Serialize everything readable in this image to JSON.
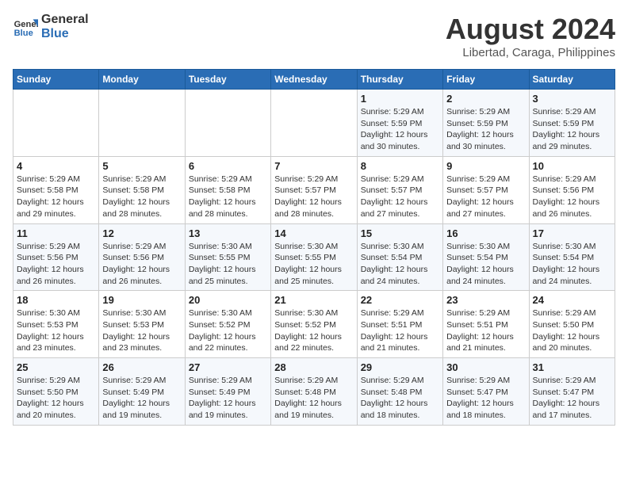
{
  "logo": {
    "line1": "General",
    "line2": "Blue"
  },
  "title": "August 2024",
  "subtitle": "Libertad, Caraga, Philippines",
  "days_of_week": [
    "Sunday",
    "Monday",
    "Tuesday",
    "Wednesday",
    "Thursday",
    "Friday",
    "Saturday"
  ],
  "weeks": [
    [
      {
        "day": "",
        "info": ""
      },
      {
        "day": "",
        "info": ""
      },
      {
        "day": "",
        "info": ""
      },
      {
        "day": "",
        "info": ""
      },
      {
        "day": "1",
        "info": "Sunrise: 5:29 AM\nSunset: 5:59 PM\nDaylight: 12 hours\nand 30 minutes."
      },
      {
        "day": "2",
        "info": "Sunrise: 5:29 AM\nSunset: 5:59 PM\nDaylight: 12 hours\nand 30 minutes."
      },
      {
        "day": "3",
        "info": "Sunrise: 5:29 AM\nSunset: 5:59 PM\nDaylight: 12 hours\nand 29 minutes."
      }
    ],
    [
      {
        "day": "4",
        "info": "Sunrise: 5:29 AM\nSunset: 5:58 PM\nDaylight: 12 hours\nand 29 minutes."
      },
      {
        "day": "5",
        "info": "Sunrise: 5:29 AM\nSunset: 5:58 PM\nDaylight: 12 hours\nand 28 minutes."
      },
      {
        "day": "6",
        "info": "Sunrise: 5:29 AM\nSunset: 5:58 PM\nDaylight: 12 hours\nand 28 minutes."
      },
      {
        "day": "7",
        "info": "Sunrise: 5:29 AM\nSunset: 5:57 PM\nDaylight: 12 hours\nand 28 minutes."
      },
      {
        "day": "8",
        "info": "Sunrise: 5:29 AM\nSunset: 5:57 PM\nDaylight: 12 hours\nand 27 minutes."
      },
      {
        "day": "9",
        "info": "Sunrise: 5:29 AM\nSunset: 5:57 PM\nDaylight: 12 hours\nand 27 minutes."
      },
      {
        "day": "10",
        "info": "Sunrise: 5:29 AM\nSunset: 5:56 PM\nDaylight: 12 hours\nand 26 minutes."
      }
    ],
    [
      {
        "day": "11",
        "info": "Sunrise: 5:29 AM\nSunset: 5:56 PM\nDaylight: 12 hours\nand 26 minutes."
      },
      {
        "day": "12",
        "info": "Sunrise: 5:29 AM\nSunset: 5:56 PM\nDaylight: 12 hours\nand 26 minutes."
      },
      {
        "day": "13",
        "info": "Sunrise: 5:30 AM\nSunset: 5:55 PM\nDaylight: 12 hours\nand 25 minutes."
      },
      {
        "day": "14",
        "info": "Sunrise: 5:30 AM\nSunset: 5:55 PM\nDaylight: 12 hours\nand 25 minutes."
      },
      {
        "day": "15",
        "info": "Sunrise: 5:30 AM\nSunset: 5:54 PM\nDaylight: 12 hours\nand 24 minutes."
      },
      {
        "day": "16",
        "info": "Sunrise: 5:30 AM\nSunset: 5:54 PM\nDaylight: 12 hours\nand 24 minutes."
      },
      {
        "day": "17",
        "info": "Sunrise: 5:30 AM\nSunset: 5:54 PM\nDaylight: 12 hours\nand 24 minutes."
      }
    ],
    [
      {
        "day": "18",
        "info": "Sunrise: 5:30 AM\nSunset: 5:53 PM\nDaylight: 12 hours\nand 23 minutes."
      },
      {
        "day": "19",
        "info": "Sunrise: 5:30 AM\nSunset: 5:53 PM\nDaylight: 12 hours\nand 23 minutes."
      },
      {
        "day": "20",
        "info": "Sunrise: 5:30 AM\nSunset: 5:52 PM\nDaylight: 12 hours\nand 22 minutes."
      },
      {
        "day": "21",
        "info": "Sunrise: 5:30 AM\nSunset: 5:52 PM\nDaylight: 12 hours\nand 22 minutes."
      },
      {
        "day": "22",
        "info": "Sunrise: 5:29 AM\nSunset: 5:51 PM\nDaylight: 12 hours\nand 21 minutes."
      },
      {
        "day": "23",
        "info": "Sunrise: 5:29 AM\nSunset: 5:51 PM\nDaylight: 12 hours\nand 21 minutes."
      },
      {
        "day": "24",
        "info": "Sunrise: 5:29 AM\nSunset: 5:50 PM\nDaylight: 12 hours\nand 20 minutes."
      }
    ],
    [
      {
        "day": "25",
        "info": "Sunrise: 5:29 AM\nSunset: 5:50 PM\nDaylight: 12 hours\nand 20 minutes."
      },
      {
        "day": "26",
        "info": "Sunrise: 5:29 AM\nSunset: 5:49 PM\nDaylight: 12 hours\nand 19 minutes."
      },
      {
        "day": "27",
        "info": "Sunrise: 5:29 AM\nSunset: 5:49 PM\nDaylight: 12 hours\nand 19 minutes."
      },
      {
        "day": "28",
        "info": "Sunrise: 5:29 AM\nSunset: 5:48 PM\nDaylight: 12 hours\nand 19 minutes."
      },
      {
        "day": "29",
        "info": "Sunrise: 5:29 AM\nSunset: 5:48 PM\nDaylight: 12 hours\nand 18 minutes."
      },
      {
        "day": "30",
        "info": "Sunrise: 5:29 AM\nSunset: 5:47 PM\nDaylight: 12 hours\nand 18 minutes."
      },
      {
        "day": "31",
        "info": "Sunrise: 5:29 AM\nSunset: 5:47 PM\nDaylight: 12 hours\nand 17 minutes."
      }
    ]
  ]
}
